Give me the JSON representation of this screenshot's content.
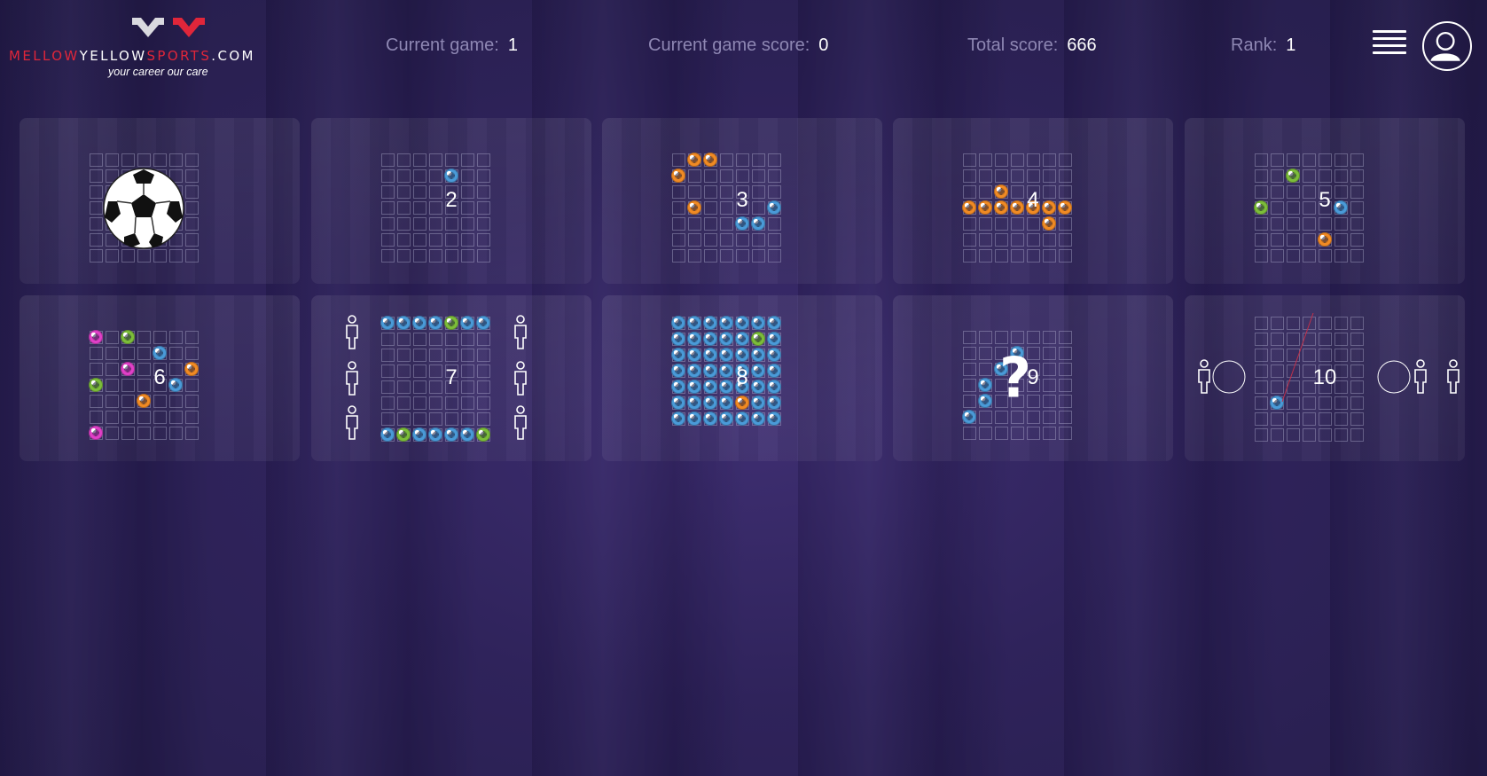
{
  "logo": {
    "text_part1": "MELLOW",
    "text_part2": "YELLOW",
    "text_part3": "SPORTS",
    "text_part4": ".COM",
    "tagline": "your career our care"
  },
  "stats": {
    "current_game_label": "Current game:",
    "current_game_value": "1",
    "current_game_score_label": "Current game score:",
    "current_game_score_value": "0",
    "total_score_label": "Total score:",
    "total_score_value": "666",
    "rank_label": "Rank:",
    "rank_value": "1"
  },
  "icons": {
    "menu": "hamburger-menu-icon",
    "profile": "user-profile-icon"
  },
  "colors": {
    "blue_ball": "#4a9ad8",
    "orange_ball": "#f08a24",
    "green_ball": "#7cbd3a",
    "pink_ball": "#e040c8",
    "accent_red": "#e0263a"
  },
  "levels": [
    {
      "label": "",
      "icon": "soccer-ball-icon",
      "state": "current"
    },
    {
      "label": "2"
    },
    {
      "label": "3"
    },
    {
      "label": "4"
    },
    {
      "label": "5"
    },
    {
      "label": "6"
    },
    {
      "label": "7"
    },
    {
      "label": "8"
    },
    {
      "label": "9",
      "overlay": "?"
    },
    {
      "label": "10"
    }
  ]
}
